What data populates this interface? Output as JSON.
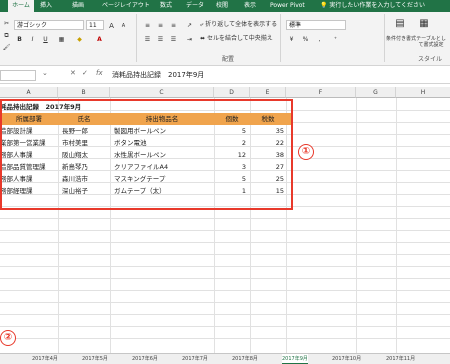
{
  "ribbon_tabs": [
    "ホーム",
    "挿入",
    "描画",
    "ページレイアウト",
    "数式",
    "データ",
    "校閲",
    "表示",
    "Power Pivot"
  ],
  "tell_me": "実行したい作業を入力してください",
  "ribbon": {
    "font_name": "游ゴシック",
    "font_size": "11",
    "wrap_text": "折り返して全体を表示する",
    "merge_center": "セルを結合して中央揃え",
    "number_format": "標準",
    "group_alignment": "配置",
    "group_style": "スタイル",
    "conditional_format": "条件付き書式",
    "format_as_table": "テーブルとして書式設定",
    "bold": "B",
    "italic": "I",
    "underline": "U",
    "percent": "%"
  },
  "formula_bar": {
    "fx": "fx",
    "formula": "消耗品持出記録　2017年9月"
  },
  "columns": [
    "A",
    "B",
    "C",
    "D",
    "E",
    "F",
    "G",
    "H"
  ],
  "sheet": {
    "title": "耗品持出記録　2017年9月",
    "headers": [
      "所属部署",
      "氏名",
      "持出物品名",
      "個数",
      "税数"
    ],
    "rows": [
      [
        "造部設計課",
        "長野一郎",
        "製図用ボールペン",
        "5",
        "35"
      ],
      [
        "業部第一営業課",
        "市村美里",
        "ボタン電池",
        "2",
        "22"
      ],
      [
        "務部人事課",
        "阪山翔太",
        "水性黒ボールペン",
        "12",
        "38"
      ],
      [
        "造部品質管理課",
        "新島琴乃",
        "クリアファイルA4",
        "3",
        "27"
      ],
      [
        "務部人事課",
        "森川浩市",
        "マスキングテープ",
        "5",
        "25"
      ],
      [
        "務部経理課",
        "深山裕子",
        "ガムテープ（太）",
        "1",
        "15"
      ]
    ]
  },
  "annotations": {
    "marker_1": "①",
    "marker_2": "②"
  },
  "sheet_tabs": [
    "2017年4月",
    "2017年5月",
    "2017年6月",
    "2017年7月",
    "2017年8月",
    "2017年9月",
    "2017年10月",
    "2017年11月"
  ],
  "active_sheet": "2017年9月",
  "colors": {
    "excel_green": "#217346",
    "header_orange": "#f0a44d",
    "highlight_red": "#e8392b"
  }
}
